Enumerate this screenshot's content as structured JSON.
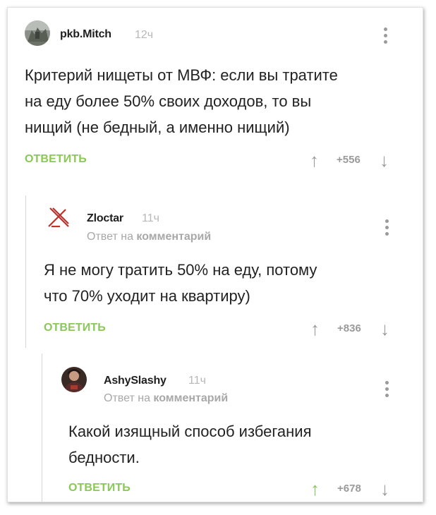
{
  "comments": [
    {
      "username": "pkb.Mitch",
      "time": "12ч",
      "reply_prefix": "",
      "reply_target": "",
      "text": "Критерий нищеты от МВФ: если вы тратите\nна еду более 50% своих доходов, то вы\nнищий (не бедный, а именно нищий)",
      "reply_label": "ОТВЕТИТЬ",
      "rating": "+556",
      "up_icon": "↑",
      "down_icon": "↓"
    },
    {
      "username": "Zloctar",
      "time": "11ч",
      "reply_prefix": "Ответ на",
      "reply_target": "комментарий",
      "text": "Я не могу тратить 50% на еду, потому\nчто  70% уходит на квартиру)",
      "reply_label": "ОТВЕТИТЬ",
      "rating": "+836",
      "up_icon": "↑",
      "down_icon": "↓"
    },
    {
      "username": "AshySlashy",
      "time": "11ч",
      "reply_prefix": "Ответ на",
      "reply_target": "комментарий",
      "text": "Какой изящный способ избегания\nбедности.",
      "reply_label": "ОТВЕТИТЬ",
      "rating": "+678",
      "up_icon": "↑",
      "down_icon": "↓",
      "upvoted": true
    }
  ],
  "colors": {
    "reply_link": "#8ac858",
    "upvote_active": "#86c45a",
    "muted": "#a8a8a8"
  },
  "icons": [
    "avatar-photo",
    "zloctar-logo-icon",
    "more-vertical-icon",
    "arrow-up-icon",
    "arrow-down-icon"
  ]
}
